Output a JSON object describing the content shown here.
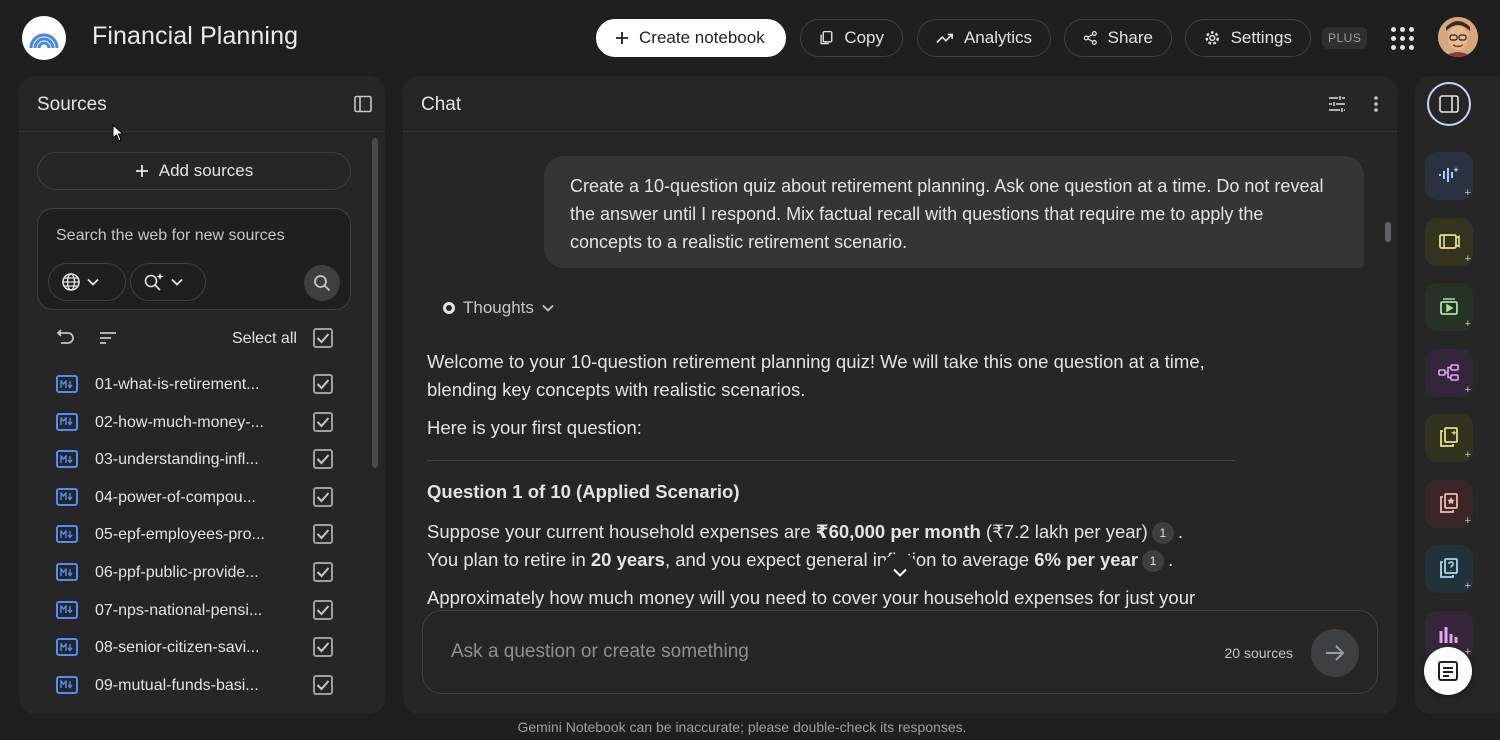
{
  "app": {
    "title": "Financial Planning"
  },
  "toolbar": {
    "create_notebook": "Create notebook",
    "copy": "Copy",
    "analytics": "Analytics",
    "share": "Share",
    "settings": "Settings",
    "plan_badge": "PLUS"
  },
  "sources": {
    "title": "Sources",
    "add_label": "Add sources",
    "search_placeholder": "Search the web for new sources",
    "select_all": "Select all",
    "items": [
      {
        "label": "01-what-is-retirement..."
      },
      {
        "label": "02-how-much-money-..."
      },
      {
        "label": "03-understanding-infl..."
      },
      {
        "label": "04-power-of-compou..."
      },
      {
        "label": "05-epf-employees-pro..."
      },
      {
        "label": "06-ppf-public-provide..."
      },
      {
        "label": "07-nps-national-pensi..."
      },
      {
        "label": "08-senior-citizen-savi..."
      },
      {
        "label": "09-mutual-funds-basi..."
      }
    ]
  },
  "chat": {
    "title": "Chat",
    "user_message": "Create a 10-question quiz about retirement planning. Ask one question at a time. Do not reveal the answer until I respond. Mix factual recall with questions that require me to apply the concepts to a realistic retirement scenario.",
    "thoughts_label": "Thoughts",
    "response": {
      "intro": "Welcome to your 10-question retirement planning quiz! We will take this one question at a time, blending key concepts with realistic scenarios.",
      "lead": "Here is your first question:",
      "question_title": "Question 1 of 10 (Applied Scenario)",
      "p1_a": "Suppose your current household expenses are ",
      "p1_b": "₹60,000 per month",
      "p1_c": " (₹7.2 lakh per year)",
      "p2_a": "You plan to retire in ",
      "p2_b": "20 years",
      "p2_c": ", and you expect general inflation to average ",
      "p2_d": "6% per year",
      "p3": "Approximately how much money will you need to cover your household expenses for just your",
      "citation": "1"
    },
    "input_placeholder": "Ask a question or create something",
    "source_count": "20 sources"
  },
  "footer": {
    "disclaimer": "Gemini Notebook can be inaccurate; please double-check its responses."
  },
  "studio": {
    "tools": [
      {
        "icon": "audio-overview-icon",
        "bg": "#2a3140"
      },
      {
        "icon": "video-overview-icon",
        "bg": "#33331f"
      },
      {
        "icon": "presentation-icon",
        "bg": "#263226"
      },
      {
        "icon": "mind-map-icon",
        "bg": "#33263a"
      },
      {
        "icon": "reports-icon",
        "bg": "#33321f"
      },
      {
        "icon": "flashcards-icon",
        "bg": "#3a2626"
      },
      {
        "icon": "quiz-icon",
        "bg": "#21323a"
      },
      {
        "icon": "infographic-icon",
        "bg": "#36263a"
      }
    ]
  }
}
